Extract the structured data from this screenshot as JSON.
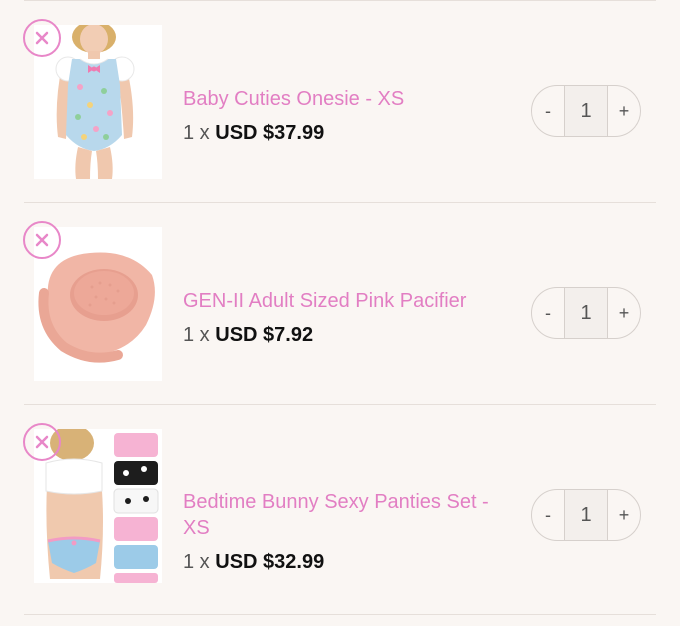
{
  "cart": {
    "items": [
      {
        "title": "Baby Cuties Onesie - XS",
        "qty_prefix": "1 x",
        "price": "USD $37.99",
        "quantity": "1",
        "minus": "-",
        "plus": "+",
        "image": "onesie-photo"
      },
      {
        "title": "GEN-II Adult Sized Pink Pacifier",
        "qty_prefix": "1 x",
        "price": "USD $7.92",
        "quantity": "1",
        "minus": "-",
        "plus": "+",
        "image": "pacifier-photo"
      },
      {
        "title": "Bedtime Bunny Sexy Panties Set - XS",
        "qty_prefix": "1 x",
        "price": "USD $32.99",
        "quantity": "1",
        "minus": "-",
        "plus": "+",
        "image": "panties-set-photo"
      }
    ],
    "remove_icon": "close-icon"
  },
  "colors": {
    "background": "#faf6f3",
    "accent_pink": "#e27ec3",
    "remove_ring": "#e887c8",
    "divider": "#e6dfda",
    "stepper_border": "#d6d0cc"
  }
}
